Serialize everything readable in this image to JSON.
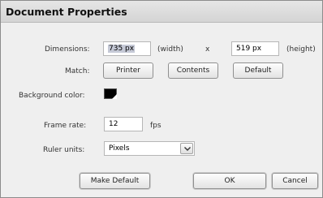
{
  "dialog": {
    "title": "Document Properties",
    "dimensions": {
      "label": "Dimensions:",
      "width_value": "735 px",
      "width_suffix": "(width)",
      "separator": "x",
      "height_value": "519 px",
      "height_suffix": "(height)"
    },
    "match": {
      "label": "Match:",
      "buttons": [
        "Printer",
        "Contents",
        "Default"
      ]
    },
    "background": {
      "label": "Background color:",
      "color": "#000000"
    },
    "frame_rate": {
      "label": "Frame rate:",
      "value": "12",
      "unit": "fps"
    },
    "ruler_units": {
      "label": "Ruler units:",
      "selected": "Pixels"
    },
    "footer": {
      "make_default_label": "Make Default",
      "ok_label": "OK",
      "cancel_label": "Cancel"
    }
  }
}
